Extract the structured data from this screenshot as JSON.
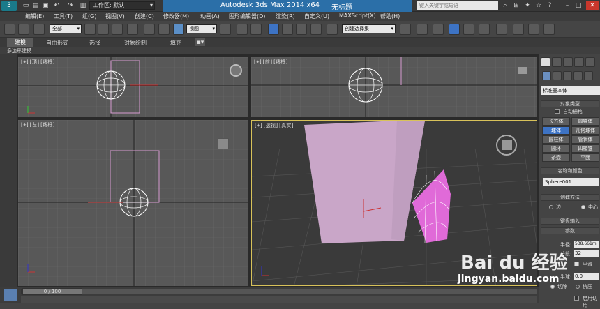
{
  "title": {
    "workspace_label": "工作区: 默认",
    "app_name": "Autodesk 3ds Max  2014 x64",
    "doc_name": "无标题",
    "search_placeholder": "键入关键字或短语"
  },
  "menu": [
    "编辑(E)",
    "工具(T)",
    "组(G)",
    "视图(V)",
    "创建(C)",
    "修改器(M)",
    "动画(A)",
    "图形编辑器(D)",
    "渲染(R)",
    "自定义(U)",
    "MAXScript(X)",
    "帮助(H)"
  ],
  "toolbar": {
    "selection_filter": "全部",
    "ref_coord": "视图",
    "selection_set": "创建选择集"
  },
  "ribbon": {
    "tabs": [
      "建模",
      "自由形式",
      "选择",
      "对象绘制",
      "填充"
    ],
    "subtab": "多边形建模"
  },
  "viewports": {
    "top": "[+][顶][线框]",
    "front": "[+][前][线框]",
    "left": "[+][左][线框]",
    "persp": "[+][透视][真实]"
  },
  "panel": {
    "category": "标准基本体",
    "object_type_header": "对象类型",
    "autogrid": "自动栅格",
    "buttons": [
      [
        "长方体",
        "圆锥体"
      ],
      [
        "球体",
        "几何球体"
      ],
      [
        "圆柱体",
        "管状体"
      ],
      [
        "圆环",
        "四棱锥"
      ],
      [
        "茶壶",
        "平面"
      ]
    ],
    "name_color_header": "名称和颜色",
    "object_name": "Sphere001",
    "creation_method_header": "创建方法",
    "creation_edge": "边",
    "creation_center": "中心",
    "keyboard_header": "键盘输入",
    "params_header": "参数",
    "radius_label": "半径:",
    "radius_value": "538.661m",
    "segments_label": "分段:",
    "segments_value": "32",
    "smooth_label": "平滑",
    "hemisphere_label": "半球:",
    "hemisphere_value": "0.0",
    "chop_label": "切除",
    "squash_label": "挤压",
    "slice_label": "启用切片"
  },
  "status": {
    "frame": "0 / 100"
  },
  "watermark": {
    "brand": "Bai du 经验",
    "url": "jingyan.baidu.com"
  }
}
